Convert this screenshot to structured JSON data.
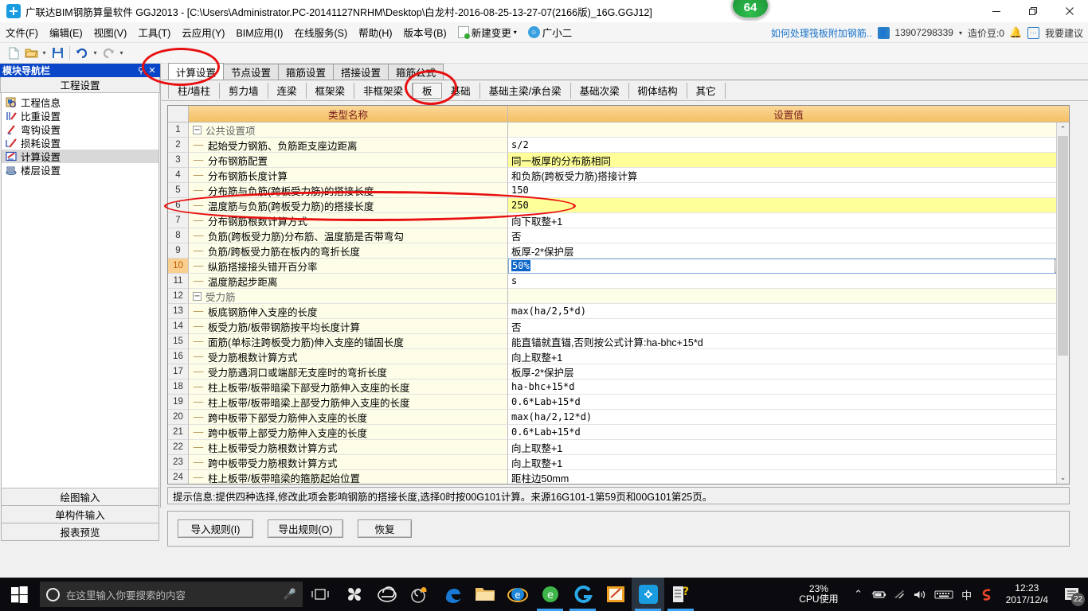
{
  "window": {
    "title": "广联达BIM钢筋算量软件 GGJ2013 - [C:\\Users\\Administrator.PC-20141127NRHM\\Desktop\\白龙村-2016-08-25-13-27-07(2166版)_16G.GGJ12]",
    "badge": "64",
    "minimize": "—",
    "maximize": "❐",
    "close": "✕"
  },
  "menu": {
    "items": [
      {
        "label": "文件(F)"
      },
      {
        "label": "编辑(E)"
      },
      {
        "label": "视图(V)"
      },
      {
        "label": "工具(T)"
      },
      {
        "label": "云应用(Y)"
      },
      {
        "label": "BIM应用(I)"
      },
      {
        "label": "在线服务(S)"
      },
      {
        "label": "帮助(H)"
      },
      {
        "label": "版本号(B)"
      }
    ],
    "new_change": "新建变更",
    "new_change_caret": "▾",
    "assistant": "广小二",
    "right": {
      "tip_link": "如何处理筏板附加钢筋..",
      "account": "13907298339",
      "account_caret": "▾",
      "beans": "造价豆:0",
      "suggest": "我要建议"
    }
  },
  "toolbar": {
    "new": "🗋",
    "open": "📂",
    "open_caret": "▾",
    "save": "💾",
    "undo": "↺",
    "undo_caret": "▾",
    "redo": "↻",
    "redo_caret": "▾"
  },
  "nav": {
    "header_title": "模块导航栏",
    "pin": "⚲",
    "close": "✕",
    "group_title": "工程设置",
    "items": [
      {
        "label": "工程信息",
        "icon": "project-info-icon",
        "selected": false
      },
      {
        "label": "比重设置",
        "icon": "weight-settings-icon",
        "selected": false
      },
      {
        "label": "弯钩设置",
        "icon": "hook-settings-icon",
        "selected": false
      },
      {
        "label": "损耗设置",
        "icon": "loss-settings-icon",
        "selected": false
      },
      {
        "label": "计算设置",
        "icon": "calc-settings-icon",
        "selected": true
      },
      {
        "label": "楼层设置",
        "icon": "floor-settings-icon",
        "selected": false
      }
    ],
    "bottom_buttons": [
      {
        "label": "绘图输入"
      },
      {
        "label": "单构件输入"
      },
      {
        "label": "报表预览"
      }
    ]
  },
  "tabs_row1": [
    {
      "label": "计算设置",
      "active": true
    },
    {
      "label": "节点设置",
      "active": false
    },
    {
      "label": "箍筋设置",
      "active": false
    },
    {
      "label": "搭接设置",
      "active": false
    },
    {
      "label": "箍筋公式",
      "active": false
    }
  ],
  "tabs_row2": [
    {
      "label": "柱/墙柱",
      "active": false
    },
    {
      "label": "剪力墙",
      "active": false
    },
    {
      "label": "连梁",
      "active": false
    },
    {
      "label": "框架梁",
      "active": false
    },
    {
      "label": "非框架梁",
      "active": false
    },
    {
      "label": "板",
      "active": true
    },
    {
      "label": "基础",
      "active": false
    },
    {
      "label": "基础主梁/承台梁",
      "active": false
    },
    {
      "label": "基础次梁",
      "active": false
    },
    {
      "label": "砌体结构",
      "active": false
    },
    {
      "label": "其它",
      "active": false
    }
  ],
  "grid": {
    "headers": {
      "num": "",
      "name": "类型名称",
      "value": "设置值"
    },
    "rows": [
      {
        "num": "1",
        "name": "公共设置项",
        "value": "",
        "kind": "group"
      },
      {
        "num": "2",
        "name": "起始受力钢筋、负筋距支座边距离",
        "value": "s/2",
        "kind": "item"
      },
      {
        "num": "3",
        "name": "分布钢筋配置",
        "value": "同一板厚的分布筋相同",
        "kind": "item",
        "highlight": true,
        "cn": true
      },
      {
        "num": "4",
        "name": "分布钢筋长度计算",
        "value": "和负筋(跨板受力筋)搭接计算",
        "kind": "item",
        "cn": true
      },
      {
        "num": "5",
        "name": "分布筋与负筋(跨板受力筋)的搭接长度",
        "value": "150",
        "kind": "item"
      },
      {
        "num": "6",
        "name": "温度筋与负筋(跨板受力筋)的搭接长度",
        "value": "250",
        "kind": "item",
        "highlight": true
      },
      {
        "num": "7",
        "name": "分布钢筋根数计算方式",
        "value": "向下取整+1",
        "kind": "item",
        "cn": true
      },
      {
        "num": "8",
        "name": "负筋(跨板受力筋)分布筋、温度筋是否带弯勾",
        "value": "否",
        "kind": "item",
        "cn": true
      },
      {
        "num": "9",
        "name": "负筋/跨板受力筋在板内的弯折长度",
        "value": "板厚-2*保护层",
        "kind": "item",
        "cn": true
      },
      {
        "num": "10",
        "name": "纵筋搭接接头错开百分率",
        "value": "50%",
        "kind": "item",
        "current": true,
        "editing": true,
        "dropdown": "⌄"
      },
      {
        "num": "11",
        "name": "温度筋起步距离",
        "value": "s",
        "kind": "item"
      },
      {
        "num": "12",
        "name": "受力筋",
        "value": "",
        "kind": "group"
      },
      {
        "num": "13",
        "name": "板底钢筋伸入支座的长度",
        "value": "max(ha/2,5*d)",
        "kind": "item"
      },
      {
        "num": "14",
        "name": "板受力筋/板带钢筋按平均长度计算",
        "value": "否",
        "kind": "item",
        "cn": true
      },
      {
        "num": "15",
        "name": "面筋(单标注跨板受力筋)伸入支座的锚固长度",
        "value": "能直锚就直锚,否则按公式计算:ha-bhc+15*d",
        "kind": "item",
        "cn": true
      },
      {
        "num": "16",
        "name": "受力筋根数计算方式",
        "value": "向上取整+1",
        "kind": "item",
        "cn": true
      },
      {
        "num": "17",
        "name": "受力筋遇洞口或端部无支座时的弯折长度",
        "value": "板厚-2*保护层",
        "kind": "item",
        "cn": true
      },
      {
        "num": "18",
        "name": "柱上板带/板带暗梁下部受力筋伸入支座的长度",
        "value": "ha-bhc+15*d",
        "kind": "item"
      },
      {
        "num": "19",
        "name": "柱上板带/板带暗梁上部受力筋伸入支座的长度",
        "value": "0.6*Lab+15*d",
        "kind": "item"
      },
      {
        "num": "20",
        "name": "跨中板带下部受力筋伸入支座的长度",
        "value": "max(ha/2,12*d)",
        "kind": "item"
      },
      {
        "num": "21",
        "name": "跨中板带上部受力筋伸入支座的长度",
        "value": "0.6*Lab+15*d",
        "kind": "item"
      },
      {
        "num": "22",
        "name": "柱上板带受力筋根数计算方式",
        "value": "向上取整+1",
        "kind": "item",
        "cn": true
      },
      {
        "num": "23",
        "name": "跨中板带受力筋根数计算方式",
        "value": "向上取整+1",
        "kind": "item",
        "cn": true
      },
      {
        "num": "24",
        "name": "柱上板带/板带暗梁的箍筋起始位置",
        "value": "距柱边50mm",
        "kind": "item",
        "cn": true
      }
    ],
    "scroll_up": "⌃",
    "scroll_down": "⌄"
  },
  "hint": {
    "label": "提示信息:",
    "text": "提供四种选择,修改此项会影响钢筋的搭接长度,选择0时按00G101计算。来源16G101-1第59页和00G101第25页。"
  },
  "footer_buttons": [
    {
      "label": "导入规则(I)"
    },
    {
      "label": "导出规则(O)"
    },
    {
      "label": "恢复"
    }
  ],
  "taskbar": {
    "search_placeholder": "在这里输入你要搜索的内容",
    "cpu_percent": "23%",
    "cpu_label": "CPU使用",
    "time": "12:23",
    "date": "2017/12/4",
    "ime": "中",
    "notif_count": "22",
    "chevron": "⌃"
  },
  "colors": {
    "accent_blue": "#0a46c8",
    "header_orange": "#f4c063",
    "highlight_yellow": "#ffff99",
    "annotation_red": "#e81010",
    "selection_blue": "#0a64c8"
  }
}
